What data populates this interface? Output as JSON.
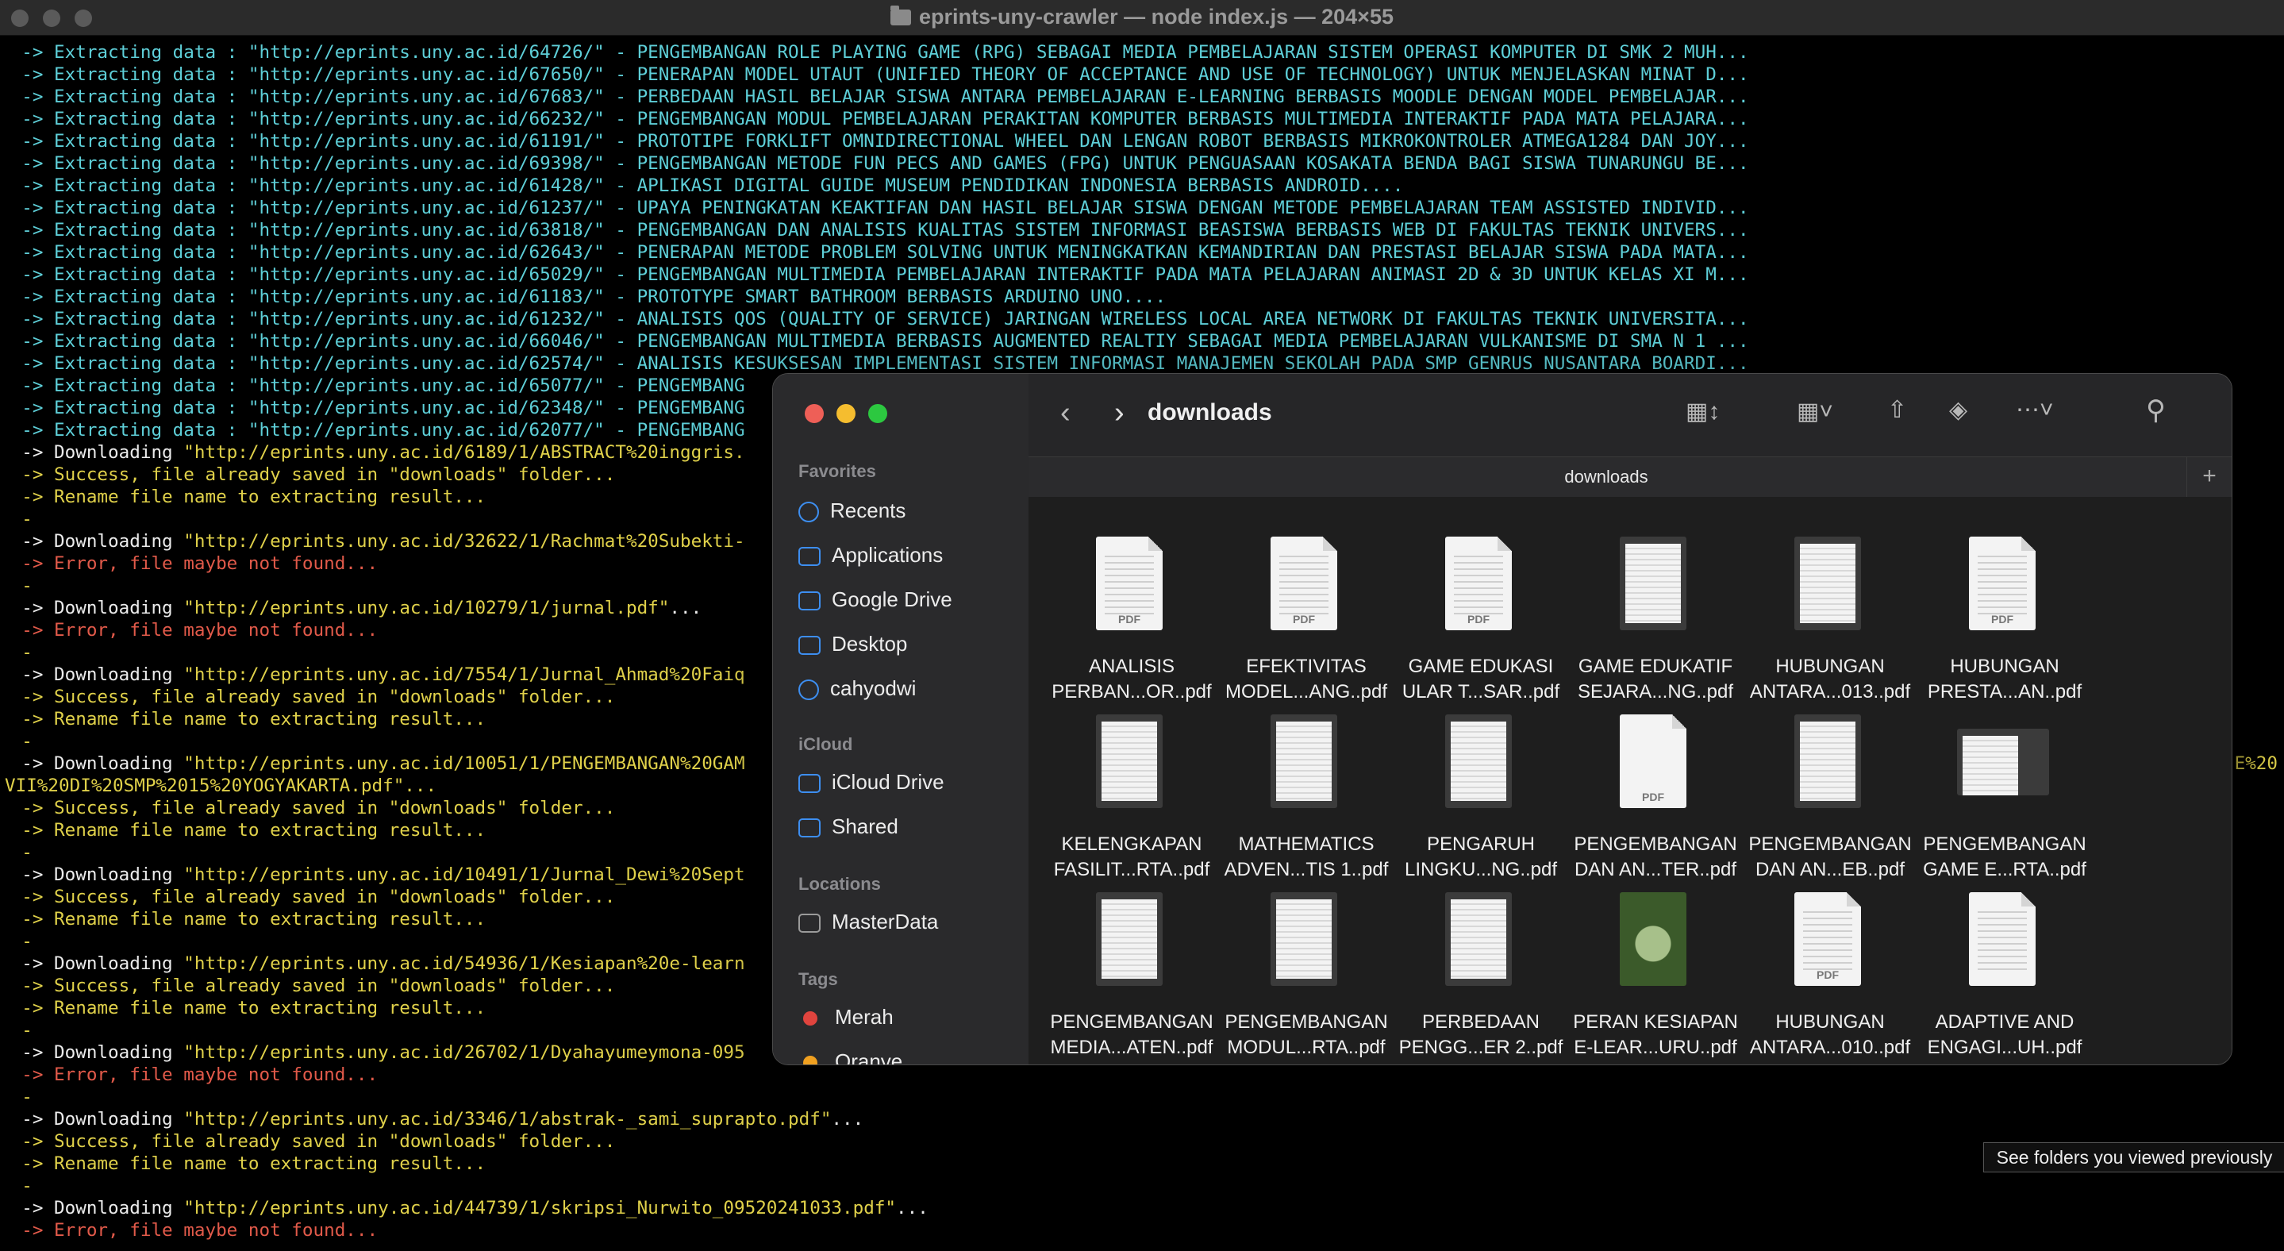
{
  "terminal": {
    "title": "eprints-uny-crawler — node index.js — 204×55",
    "lines": [
      {
        "text": "-> Extracting data : \"http://eprints.uny.ac.id/64726/\" - PENGEMBANGAN ROLE PLAYING GAME (RPG) SEBAGAI MEDIA PEMBELAJARAN SISTEM OPERASI KOMPUTER DI SMK 2 MUH...",
        "color": "cyan"
      },
      {
        "text": "-> Extracting data : \"http://eprints.uny.ac.id/67650/\" - PENERAPAN MODEL UTAUT (UNIFIED THEORY OF ACCEPTANCE AND USE OF TECHNOLOGY) UNTUK MENJELASKAN MINAT D...",
        "color": "cyan"
      },
      {
        "text": "-> Extracting data : \"http://eprints.uny.ac.id/67683/\" - PERBEDAAN HASIL BELAJAR SISWA ANTARA PEMBELAJARAN E-LEARNING BERBASIS MOODLE DENGAN MODEL PEMBELAJAR...",
        "color": "cyan"
      },
      {
        "text": "-> Extracting data : \"http://eprints.uny.ac.id/66232/\" - PENGEMBANGAN MODUL PEMBELAJARAN PERAKITAN KOMPUTER BERBASIS MULTIMEDIA INTERAKTIF PADA MATA PELAJARA...",
        "color": "cyan"
      },
      {
        "text": "-> Extracting data : \"http://eprints.uny.ac.id/61191/\" - PROTOTIPE FORKLIFT OMNIDIRECTIONAL WHEEL DAN LENGAN ROBOT BERBASIS MIKROKONTROLER ATMEGA1284 DAN JOY...",
        "color": "cyan"
      },
      {
        "text": "-> Extracting data : \"http://eprints.uny.ac.id/69398/\" - PENGEMBANGAN METODE FUN PECS AND GAMES (FPG) UNTUK PENGUASAAN KOSAKATA BENDA BAGI SISWA TUNARUNGU BE...",
        "color": "cyan"
      },
      {
        "text": "-> Extracting data : \"http://eprints.uny.ac.id/61428/\" - APLIKASI DIGITAL GUIDE MUSEUM PENDIDIKAN INDONESIA BERBASIS ANDROID....",
        "color": "cyan"
      },
      {
        "text": "-> Extracting data : \"http://eprints.uny.ac.id/61237/\" - UPAYA PENINGKATAN KEAKTIFAN DAN HASIL BELAJAR SISWA DENGAN METODE PEMBELAJARAN TEAM ASSISTED INDIVID...",
        "color": "cyan"
      },
      {
        "text": "-> Extracting data : \"http://eprints.uny.ac.id/63818/\" - PENGEMBANGAN DAN ANALISIS KUALITAS SISTEM INFORMASI BEASISWA BERBASIS WEB DI FAKULTAS TEKNIK UNIVERS...",
        "color": "cyan"
      },
      {
        "text": "-> Extracting data : \"http://eprints.uny.ac.id/62643/\" - PENERAPAN METODE PROBLEM SOLVING UNTUK MENINGKATKAN KEMANDIRIAN DAN PRESTASI BELAJAR SISWA PADA MATA...",
        "color": "cyan"
      },
      {
        "text": "-> Extracting data : \"http://eprints.uny.ac.id/65029/\" - PENGEMBANGAN MULTIMEDIA PEMBELAJARAN INTERAKTIF PADA MATA PELAJARAN ANIMASI 2D & 3D UNTUK KELAS XI M...",
        "color": "cyan"
      },
      {
        "text": "-> Extracting data : \"http://eprints.uny.ac.id/61183/\" - PROTOTYPE SMART BATHROOM BERBASIS ARDUINO UNO....",
        "color": "cyan"
      },
      {
        "text": "-> Extracting data : \"http://eprints.uny.ac.id/61232/\" - ANALISIS QOS (QUALITY OF SERVICE) JARINGAN WIRELESS LOCAL AREA NETWORK DI FAKULTAS TEKNIK UNIVERSITA...",
        "color": "cyan"
      },
      {
        "text": "-> Extracting data : \"http://eprints.uny.ac.id/66046/\" - PENGEMBANGAN MULTIMEDIA BERBASIS AUGMENTED REALTIY SEBAGAI MEDIA PEMBELAJARAN VULKANISME DI SMA N 1 ...",
        "color": "cyan"
      },
      {
        "text": "-> Extracting data : \"http://eprints.uny.ac.id/62574/\" - ANALISIS KESUKSESAN IMPLEMENTASI SISTEM INFORMASI MANAJEMEN SEKOLAH PADA SMP GENRUS NUSANTARA BOARDI...",
        "color": "cyan"
      },
      {
        "text": "-> Extracting data : \"http://eprints.uny.ac.id/65077/\" - PENGEMBANG",
        "color": "cyan"
      },
      {
        "text": "-> Extracting data : \"http://eprints.uny.ac.id/62348/\" - PENGEMBANG",
        "color": "cyan"
      },
      {
        "text": "-> Extracting data : \"http://eprints.uny.ac.id/62077/\" - PENGEMBANG",
        "color": "cyan"
      },
      {
        "prefix": "-> Downloading ",
        "url": "\"http://eprints.uny.ac.id/6189/1/ABSTRACT%20inggris.",
        "suffix": ""
      },
      {
        "text": "-> Success, file already saved in \"downloads\" folder...",
        "color": "yellow"
      },
      {
        "text": "-> Rename file name to extracting result...",
        "color": "yellow"
      },
      {
        "text": "-",
        "color": "yellow"
      },
      {
        "prefix": "-> Downloading ",
        "url": "\"http://eprints.uny.ac.id/32622/1/Rachmat%20Subekti-",
        "suffix": ""
      },
      {
        "text": "-> Error, file maybe not found...",
        "color": "red"
      },
      {
        "text": "-",
        "color": "yellow"
      },
      {
        "prefix": "-> Downloading ",
        "url": "\"http://eprints.uny.ac.id/10279/1/jurnal.pdf\"",
        "suffix": "..."
      },
      {
        "text": "-> Error, file maybe not found...",
        "color": "red"
      },
      {
        "text": "-",
        "color": "yellow"
      },
      {
        "prefix": "-> Downloading ",
        "url": "\"http://eprints.uny.ac.id/7554/1/Jurnal_Ahmad%20Faiq",
        "suffix": ""
      },
      {
        "text": "-> Success, file already saved in \"downloads\" folder...",
        "color": "yellow"
      },
      {
        "text": "-> Rename file name to extracting result...",
        "color": "yellow"
      },
      {
        "text": "-",
        "color": "yellow"
      },
      {
        "prefix": "-> Downloading ",
        "url": "\"http://eprints.uny.ac.id/10051/1/PENGEMBANGAN%20GAM",
        "suffix": "",
        "tail": "E%20"
      },
      {
        "text": "VII%20DI%20SMP%2015%20YOGYAKARTA.pdf\"...",
        "color": "yellow",
        "noindent": true
      },
      {
        "text": "-> Success, file already saved in \"downloads\" folder...",
        "color": "yellow"
      },
      {
        "text": "-> Rename file name to extracting result...",
        "color": "yellow"
      },
      {
        "text": "-",
        "color": "yellow"
      },
      {
        "prefix": "-> Downloading ",
        "url": "\"http://eprints.uny.ac.id/10491/1/Jurnal_Dewi%20Sept",
        "suffix": ""
      },
      {
        "text": "-> Success, file already saved in \"downloads\" folder...",
        "color": "yellow"
      },
      {
        "text": "-> Rename file name to extracting result...",
        "color": "yellow"
      },
      {
        "text": "-",
        "color": "yellow"
      },
      {
        "prefix": "-> Downloading ",
        "url": "\"http://eprints.uny.ac.id/54936/1/Kesiapan%20e-learn",
        "suffix": ""
      },
      {
        "text": "-> Success, file already saved in \"downloads\" folder...",
        "color": "yellow"
      },
      {
        "text": "-> Rename file name to extracting result...",
        "color": "yellow"
      },
      {
        "text": "-",
        "color": "yellow"
      },
      {
        "prefix": "-> Downloading ",
        "url": "\"http://eprints.uny.ac.id/26702/1/Dyahayumeymona-095",
        "suffix": ""
      },
      {
        "text": "-> Error, file maybe not found...",
        "color": "red"
      },
      {
        "text": "-",
        "color": "yellow"
      },
      {
        "prefix": "-> Downloading ",
        "url": "\"http://eprints.uny.ac.id/3346/1/abstrak-_sami_suprapto.pdf\"",
        "suffix": "..."
      },
      {
        "text": "-> Success, file already saved in \"downloads\" folder...",
        "color": "yellow"
      },
      {
        "text": "-> Rename file name to extracting result...",
        "color": "yellow"
      },
      {
        "text": "-",
        "color": "yellow"
      },
      {
        "prefix": "-> Downloading ",
        "url": "\"http://eprints.uny.ac.id/44739/1/skripsi_Nurwito_09520241033.pdf\"",
        "suffix": "..."
      },
      {
        "text": "-> Error, file maybe not found...",
        "color": "red"
      }
    ]
  },
  "finder": {
    "title": "downloads",
    "pathbar": "downloads",
    "sidebar": {
      "favorites_header": "Favorites",
      "favorites": [
        {
          "label": "Recents",
          "icon": "clock-icon"
        },
        {
          "label": "Applications",
          "icon": "applications-icon"
        },
        {
          "label": "Google Drive",
          "icon": "drive-folder-icon"
        },
        {
          "label": "Desktop",
          "icon": "desktop-icon"
        },
        {
          "label": "cahyodwi",
          "icon": "home-icon"
        }
      ],
      "icloud_header": "iCloud",
      "icloud": [
        {
          "label": "iCloud Drive",
          "icon": "cloud-icon"
        },
        {
          "label": "Shared",
          "icon": "shared-folder-icon"
        }
      ],
      "locations_header": "Locations",
      "locations": [
        {
          "label": "MasterData",
          "icon": "disk-icon"
        }
      ],
      "tags_header": "Tags",
      "tags": [
        {
          "label": "Merah",
          "color": "#e0443e"
        },
        {
          "label": "Oranye",
          "color": "#f0a020"
        }
      ]
    },
    "files": [
      {
        "line1": "ANALISIS",
        "line2": "PERBAN...OR..pdf",
        "style": "fold",
        "pdf": "PDF"
      },
      {
        "line1": "EFEKTIVITAS",
        "line2": "MODEL...ANG..pdf",
        "style": "fold",
        "pdf": "PDF"
      },
      {
        "line1": "GAME EDUKASI",
        "line2": "ULAR T...SAR..pdf",
        "style": "fold",
        "pdf": "PDF"
      },
      {
        "line1": "GAME EDUKATIF",
        "line2": "SEJARA...NG..pdf",
        "style": "dark",
        "pdf": ""
      },
      {
        "line1": "HUBUNGAN",
        "line2": "ANTARA...013..pdf",
        "style": "dark",
        "pdf": ""
      },
      {
        "line1": "HUBUNGAN",
        "line2": "PRESTA...AN..pdf",
        "style": "fold",
        "pdf": "PDF"
      },
      {
        "line1": "KELENGKAPAN",
        "line2": "FASILIT...RTA..pdf",
        "style": "dark",
        "pdf": ""
      },
      {
        "line1": "MATHEMATICS",
        "line2": "ADVEN...TIS 1..pdf",
        "style": "dark",
        "pdf": ""
      },
      {
        "line1": "PENGARUH",
        "line2": "LINGKU...NG..pdf",
        "style": "dark",
        "pdf": ""
      },
      {
        "line1": "PENGEMBANGAN",
        "line2": "DAN AN...TER..pdf",
        "style": "plainfold",
        "pdf": "PDF"
      },
      {
        "line1": "PENGEMBANGAN",
        "line2": "DAN AN...EB..pdf",
        "style": "dark",
        "pdf": ""
      },
      {
        "line1": "PENGEMBANGAN",
        "line2": "GAME E...RTA..pdf",
        "style": "land",
        "pdf": ""
      },
      {
        "line1": "PENGEMBANGAN",
        "line2": "MEDIA...ATEN..pdf",
        "style": "dark",
        "pdf": ""
      },
      {
        "line1": "PENGEMBANGAN",
        "line2": "MODUL...RTA..pdf",
        "style": "dark",
        "pdf": ""
      },
      {
        "line1": "PERBEDAAN",
        "line2": "PENGG...ER 2..pdf",
        "style": "dark",
        "pdf": ""
      },
      {
        "line1": "PERAN KESIAPAN",
        "line2": "E-LEAR...URU..pdf",
        "style": "cover",
        "pdf": ""
      },
      {
        "line1": "HUBUNGAN",
        "line2": "ANTARA...010..pdf",
        "style": "fold",
        "pdf": "PDF"
      },
      {
        "line1": "ADAPTIVE AND",
        "line2": "ENGAGI...UH..pdf",
        "style": "fold",
        "pdf": ""
      }
    ]
  },
  "tooltip": "See folders you viewed previously"
}
